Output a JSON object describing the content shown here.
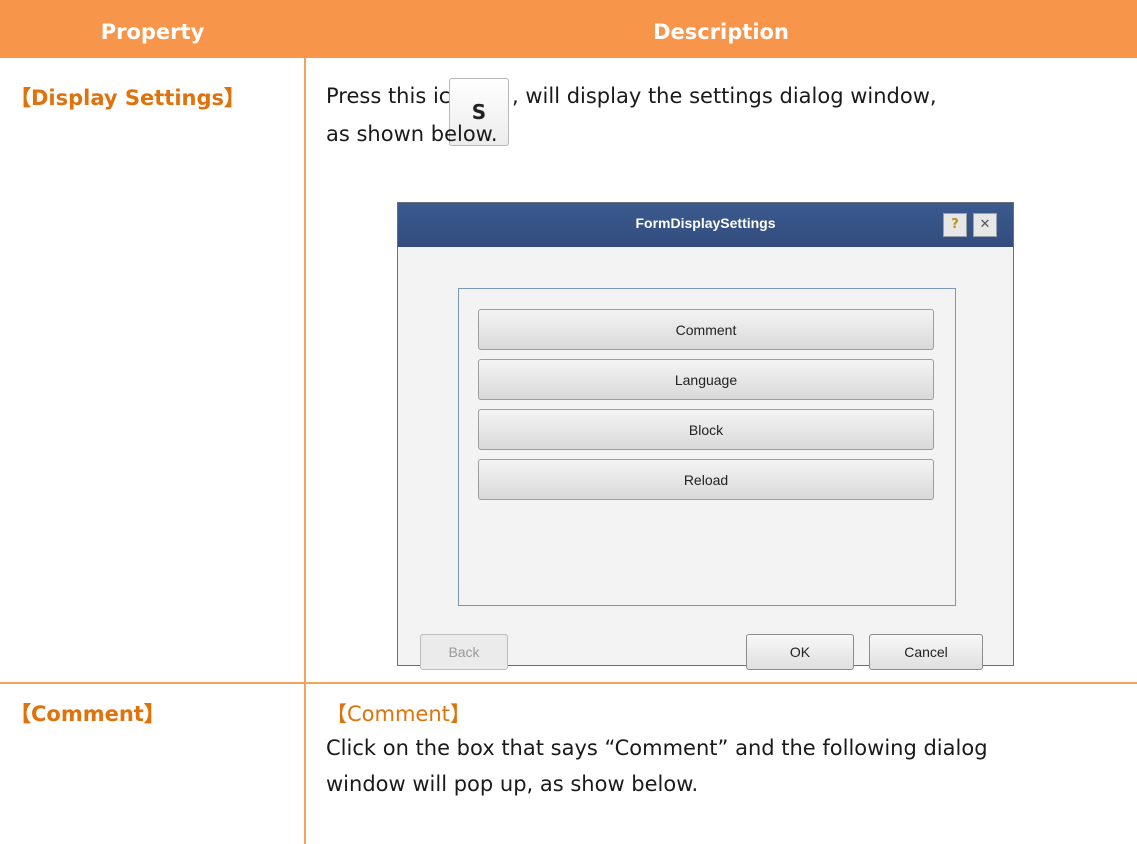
{
  "colors": {
    "header_bg": "#f7964a",
    "accent_text": "#e0720c",
    "rule": "#f2a55a"
  },
  "table": {
    "headers": [
      "Property",
      "Description"
    ],
    "rows": [
      {
        "property": "【Display Settings】",
        "desc_lines": [
          "Press this icon",
          ", will display the settings dialog window,",
          "as shown below."
        ],
        "icon_glyph": "S"
      },
      {
        "property": "【Comment】",
        "desc_lines": [
          "【Comment】",
          "Click on the box that says “Comment” and the following dialog",
          "window will pop up, as show below."
        ]
      }
    ]
  },
  "dialog": {
    "title": "FormDisplaySettings",
    "help_glyph": "?",
    "close_glyph": "✕",
    "buttons": [
      "Comment",
      "Language",
      "Block",
      "Reload"
    ],
    "footer": {
      "back": "Back",
      "ok": "OK",
      "cancel": "Cancel"
    }
  }
}
